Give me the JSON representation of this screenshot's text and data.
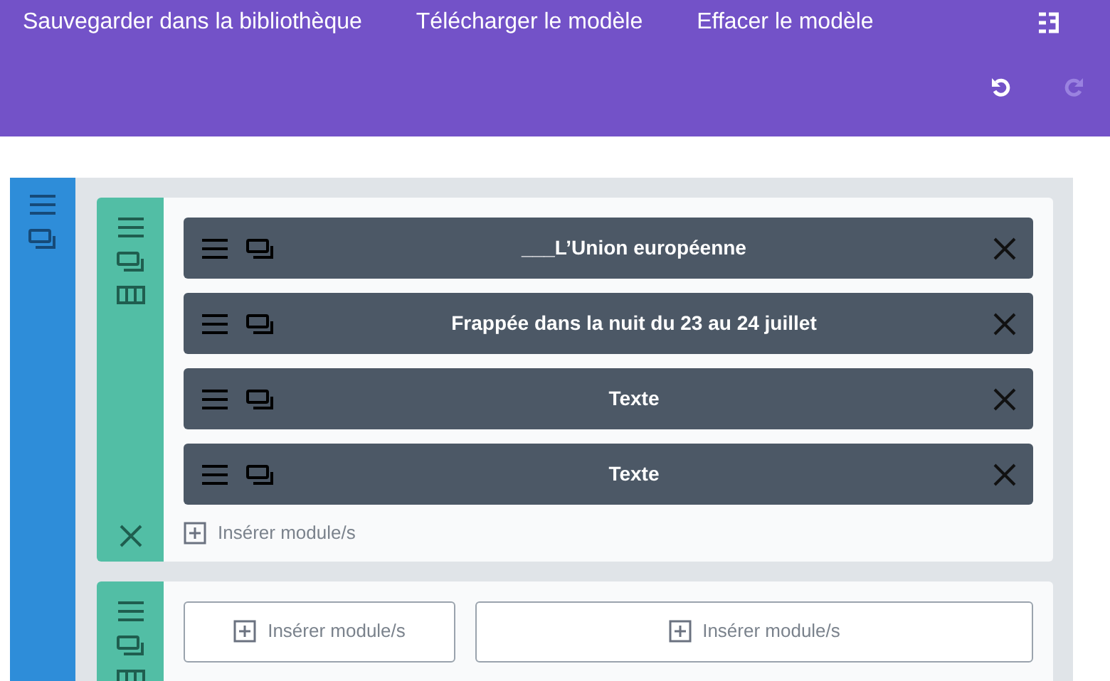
{
  "toolbar": {
    "actions": [
      {
        "label": "Sauvegarder dans la bibliothèque"
      },
      {
        "label": "Télécharger le modèle"
      },
      {
        "label": "Effacer le modèle"
      }
    ],
    "undo": {
      "disabled": false
    },
    "redo": {
      "disabled": true
    }
  },
  "rows": [
    {
      "modules": [
        {
          "title": "___L’Union européenne"
        },
        {
          "title": "Frappée dans la nuit du 23 au 24 juillet"
        },
        {
          "title": "Texte"
        },
        {
          "title": "Texte"
        }
      ],
      "insert_labels": [
        "Insérer module/s"
      ]
    },
    {
      "modules": [],
      "insert_labels": [
        "Insérer module/s",
        "Insérer module/s"
      ]
    }
  ]
}
